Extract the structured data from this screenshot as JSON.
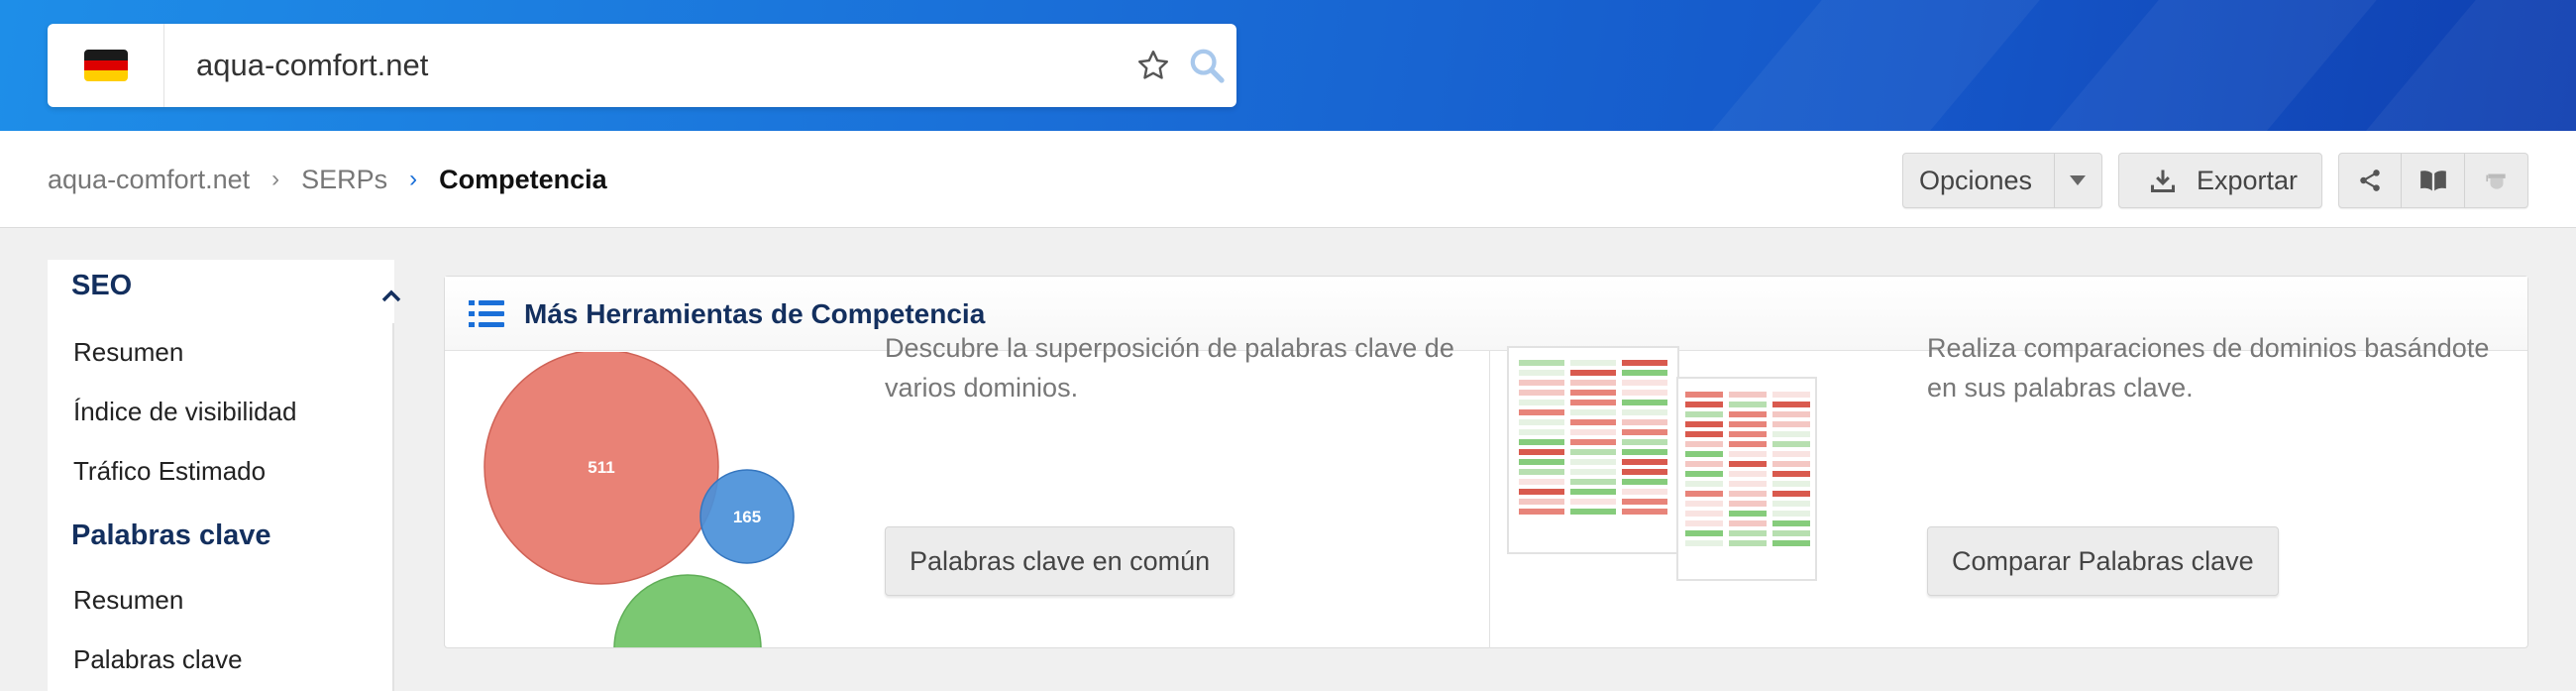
{
  "search": {
    "value": "aqua-comfort.net",
    "flag_icon": "germany-flag-icon",
    "flag_colors": [
      "#000000",
      "#dd0000",
      "#ffce00"
    ]
  },
  "breadcrumb": {
    "items": [
      "aqua-comfort.net",
      "SERPs",
      "Competencia"
    ]
  },
  "toolbar": {
    "options_label": "Opciones",
    "export_label": "Exportar",
    "icons": [
      "share-icon",
      "book-icon",
      "graduation-cap-icon"
    ]
  },
  "sidebar": {
    "sections": [
      {
        "title": "SEO",
        "items": [
          "Resumen",
          "Índice de visibilidad",
          "Tráfico Estimado"
        ]
      },
      {
        "title": "Palabras clave",
        "items": [
          "Resumen",
          "Palabras clave"
        ]
      }
    ]
  },
  "card": {
    "title": "Más Herramientas de Competencia",
    "left": {
      "description": "Descubre la superposición de palabras clave de varios dominios.",
      "button": "Palabras clave en común",
      "venn_values": [
        "511",
        "165"
      ]
    },
    "right": {
      "description": "Realiza comparaciones de dominios basándote en sus palabras clave.",
      "button": "Comparar Palabras clave"
    }
  },
  "colors": {
    "brand_dark": "#132f5e",
    "accent": "#1a6fd8",
    "venn_red": "#e87d70",
    "venn_blue": "#4a90d9",
    "venn_green": "#7bc872"
  }
}
